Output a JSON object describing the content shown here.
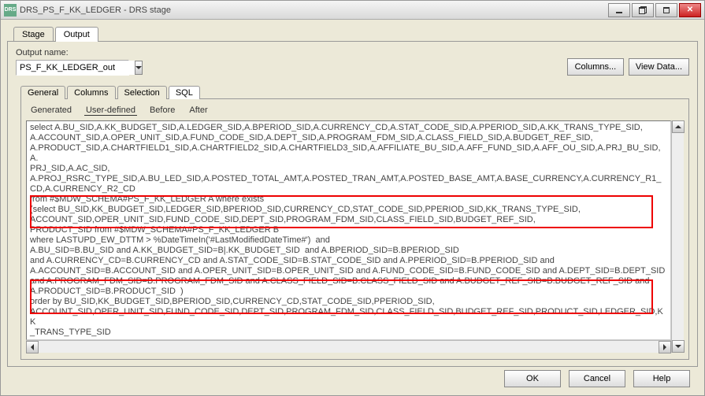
{
  "window": {
    "title": "DRS_PS_F_KK_LEDGER - DRS stage",
    "icon_text": "DRS"
  },
  "outer_tabs": [
    "Stage",
    "Output"
  ],
  "outer_tabs_active": 1,
  "output_name": {
    "label": "Output name:",
    "value": "PS_F_KK_LEDGER_out"
  },
  "panel_buttons": {
    "columns": "Columns...",
    "view_data": "View Data..."
  },
  "inner_tabs": [
    "General",
    "Columns",
    "Selection",
    "SQL"
  ],
  "inner_tabs_active": 3,
  "sub_tabs": [
    "Generated",
    "User-defined",
    "Before",
    "After"
  ],
  "sub_tabs_active": 1,
  "sql_lines": [
    "select A.BU_SID,A.KK_BUDGET_SID,A.LEDGER_SID,A.BPERIOD_SID,A.CURRENCY_CD,A.STAT_CODE_SID,A.PPERIOD_SID,A.KK_TRANS_TYPE_SID,",
    "A.ACCOUNT_SID,A.OPER_UNIT_SID,A.FUND_CODE_SID,A.DEPT_SID,A.PROGRAM_FDM_SID,A.CLASS_FIELD_SID,A.BUDGET_REF_SID,",
    "A.PRODUCT_SID,A.CHARTFIELD1_SID,A.CHARTFIELD2_SID,A.CHARTFIELD3_SID,A.AFFILIATE_BU_SID,A.AFF_FUND_SID,A.AFF_OU_SID,A.PRJ_BU_SID,A.",
    "PRJ_SID,A.AC_SID,",
    "A.PROJ_RSRC_TYPE_SID,A.BU_LED_SID,A.POSTED_TOTAL_AMT,A.POSTED_TRAN_AMT,A.POSTED_BASE_AMT,A.BASE_CURRENCY,A.CURRENCY_R1_",
    "CD,A.CURRENCY_R2_CD",
    "from #$MDW_SCHEMA#PS_F_KK_LEDGER A where exists",
    "(select BU_SID,KK_BUDGET_SID,LEDGER_SID,BPERIOD_SID,CURRENCY_CD,STAT_CODE_SID,PPERIOD_SID,KK_TRANS_TYPE_SID,",
    "ACCOUNT_SID,OPER_UNIT_SID,FUND_CODE_SID,DEPT_SID,PROGRAM_FDM_SID,CLASS_FIELD_SID,BUDGET_REF_SID,",
    "PRODUCT_SID from #$MDW_SCHEMA#PS_F_KK_LEDGER B",
    "where LASTUPD_EW_DTTM > %DateTimeIn('#LastModifiedDateTime#')  and",
    "A.BU_SID=B.BU_SID and A.KK_BUDGET_SID=B|.KK_BUDGET_SID  and A.BPERIOD_SID=B.BPERIOD_SID",
    "and A.CURRENCY_CD=B.CURRENCY_CD and A.STAT_CODE_SID=B.STAT_CODE_SID and A.PPERIOD_SID=B.PPERIOD_SID and",
    "A.ACCOUNT_SID=B.ACCOUNT_SID and A.OPER_UNIT_SID=B.OPER_UNIT_SID and A.FUND_CODE_SID=B.FUND_CODE_SID and A.DEPT_SID=B.DEPT_SID",
    "and A.PROGRAM_FDM_SID=B.PROGRAM_FDM_SID and A.CLASS_FIELD_SID=B.CLASS_FIELD_SID and A.BUDGET_REF_SID=B.BUDGET_REF_SID and",
    "A.PRODUCT_SID=B.PRODUCT_SID  )",
    "order by BU_SID,KK_BUDGET_SID,BPERIOD_SID,CURRENCY_CD,STAT_CODE_SID,PPERIOD_SID,",
    "ACCOUNT_SID,OPER_UNIT_SID,FUND_CODE_SID,DEPT_SID,PROGRAM_FDM_SID,CLASS_FIELD_SID,BUDGET_REF_SID,PRODUCT_SID,LEDGER_SID,KK",
    "_TRANS_TYPE_SID"
  ],
  "footer": {
    "ok": "OK",
    "cancel": "Cancel",
    "help": "Help"
  }
}
